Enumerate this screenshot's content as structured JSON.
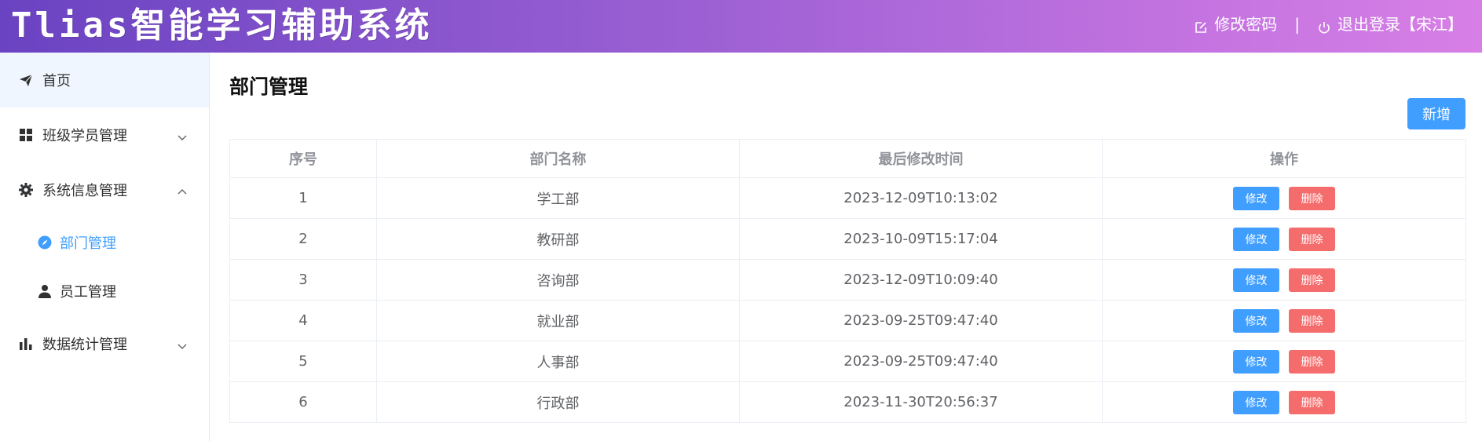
{
  "header": {
    "title": "Tlias智能学习辅助系统",
    "change_password": "修改密码",
    "separator": "|",
    "logout": "退出登录【宋江】"
  },
  "sidebar": {
    "home": "首页",
    "class_student": "班级学员管理",
    "system_info": "系统信息管理",
    "dept_mgmt": "部门管理",
    "emp_mgmt": "员工管理",
    "stats": "数据统计管理"
  },
  "main": {
    "title": "部门管理",
    "add_button": "新增",
    "columns": [
      "序号",
      "部门名称",
      "最后修改时间",
      "操作"
    ],
    "edit_label": "修改",
    "delete_label": "删除",
    "rows": [
      {
        "no": "1",
        "name": "学工部",
        "time": "2023-12-09T10:13:02"
      },
      {
        "no": "2",
        "name": "教研部",
        "time": "2023-10-09T15:17:04"
      },
      {
        "no": "3",
        "name": "咨询部",
        "time": "2023-12-09T10:09:40"
      },
      {
        "no": "4",
        "name": "就业部",
        "time": "2023-09-25T09:47:40"
      },
      {
        "no": "5",
        "name": "人事部",
        "time": "2023-09-25T09:47:40"
      },
      {
        "no": "6",
        "name": "行政部",
        "time": "2023-11-30T20:56:37"
      }
    ]
  },
  "colors": {
    "primary": "#409eff",
    "danger": "#f56c6c",
    "header_gradient_start": "#6a43c2",
    "header_gradient_end": "#d77fe6"
  },
  "icons": {
    "home": "paper-plane-icon",
    "class_student": "grid-icon",
    "system_info": "gear-icon",
    "dept_mgmt": "compass-icon",
    "emp_mgmt": "user-icon",
    "stats": "bar-chart-icon",
    "change_password": "edit-icon",
    "logout": "power-icon"
  }
}
